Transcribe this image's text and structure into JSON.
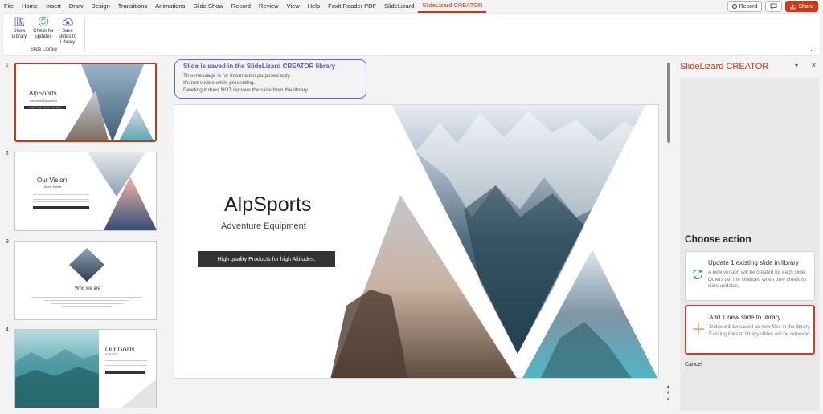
{
  "menu": {
    "tabs": [
      "File",
      "Home",
      "Insert",
      "Draw",
      "Design",
      "Transitions",
      "Animations",
      "Slide Show",
      "Record",
      "Review",
      "View",
      "Help",
      "Foxit Reader PDF",
      "SlideLizard",
      "SlideLizard CREATOR"
    ],
    "active_tab": "SlideLizard CREATOR",
    "record_label": "Record",
    "share_label": "Share"
  },
  "ribbon": {
    "buttons": [
      {
        "label": "Show Library",
        "icon": "books-icon"
      },
      {
        "label": "Check for updates",
        "icon": "refresh-icon"
      },
      {
        "label": "Save slides to Library",
        "icon": "cloud-save-icon"
      }
    ],
    "group_label": "Slide Library"
  },
  "thumbnails": [
    {
      "number": "1",
      "title": "AlpSports",
      "subtitle": "Adventure Equipment",
      "bar": "High quality Products for high Altitudes."
    },
    {
      "number": "2",
      "title": "Our Vision",
      "subtitle": "Alpine Market"
    },
    {
      "number": "3",
      "title": "Who we are"
    },
    {
      "number": "4",
      "title": "Our Goals",
      "subtitle": "SUBTITLE"
    }
  ],
  "notice": {
    "title": "Slide is saved in the SlideLizard CREATOR library",
    "lines": [
      "This message is for information purposes only.",
      "It's not visible while presenting.",
      "Deleting it does NOT remove the slide from the library."
    ]
  },
  "slide": {
    "title": "AlpSports",
    "subtitle": "Adventure Equipment",
    "bar_text": "High quality Products for high Altitudes."
  },
  "panel": {
    "title": "SlideLizard CREATOR",
    "heading": "Choose action",
    "cards": [
      {
        "title": "Update 1 existing slide in library",
        "text": "A new version will be created for each slide. Others get the changes when they check for slide updates.",
        "icon": "sync-icon"
      },
      {
        "title": "Add 1 new slide to library",
        "text": "Slides will be saved as new files in the library. Existing links to library slides will be removed.",
        "icon": "plus-icon"
      }
    ],
    "cancel_label": "Cancel"
  },
  "colors": {
    "accent": "#c4391a",
    "notice_border": "#7a5cc9",
    "highlight": "#d8373a"
  }
}
